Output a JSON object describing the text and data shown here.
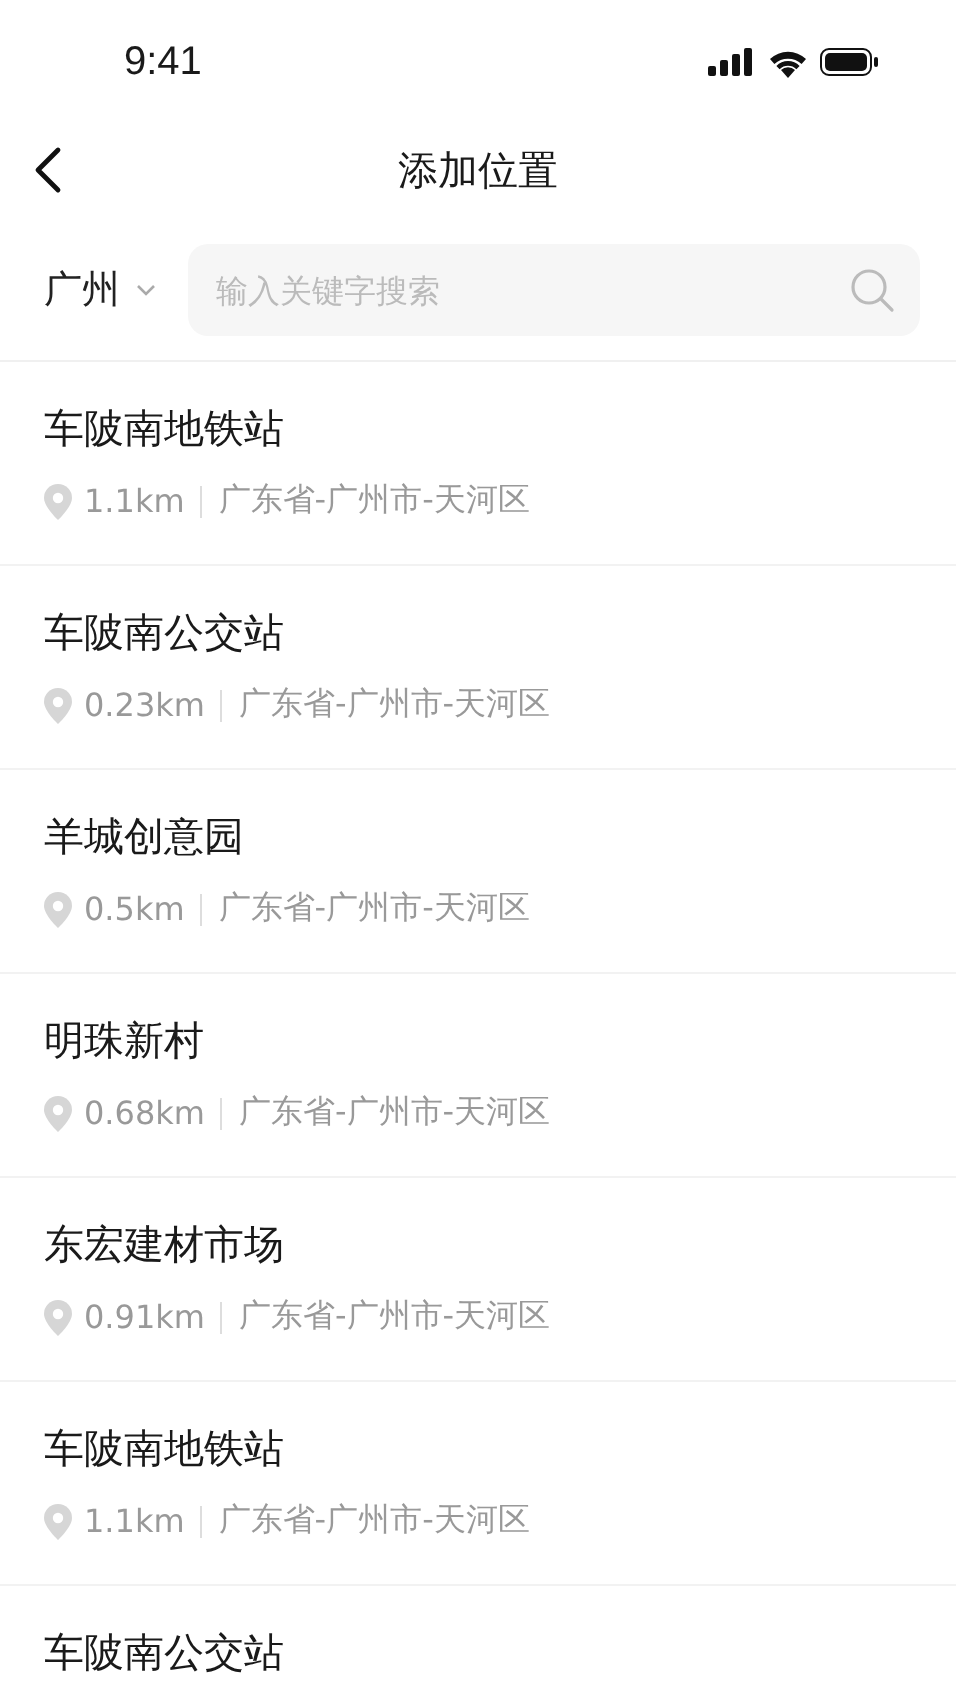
{
  "status_bar": {
    "time": "9:41"
  },
  "nav": {
    "title": "添加位置"
  },
  "search": {
    "city": "广州",
    "placeholder": "输入关键字搜索"
  },
  "places": [
    {
      "name": "车陂南地铁站",
      "distance": "1.1km",
      "address": "广东省-广州市-天河区"
    },
    {
      "name": "车陂南公交站",
      "distance": "0.23km",
      "address": "广东省-广州市-天河区"
    },
    {
      "name": "羊城创意园",
      "distance": "0.5km",
      "address": "广东省-广州市-天河区"
    },
    {
      "name": "明珠新村",
      "distance": "0.68km",
      "address": "广东省-广州市-天河区"
    },
    {
      "name": "东宏建材市场",
      "distance": "0.91km",
      "address": "广东省-广州市-天河区"
    },
    {
      "name": "车陂南地铁站",
      "distance": "1.1km",
      "address": "广东省-广州市-天河区"
    },
    {
      "name": "车陂南公交站"
    }
  ]
}
